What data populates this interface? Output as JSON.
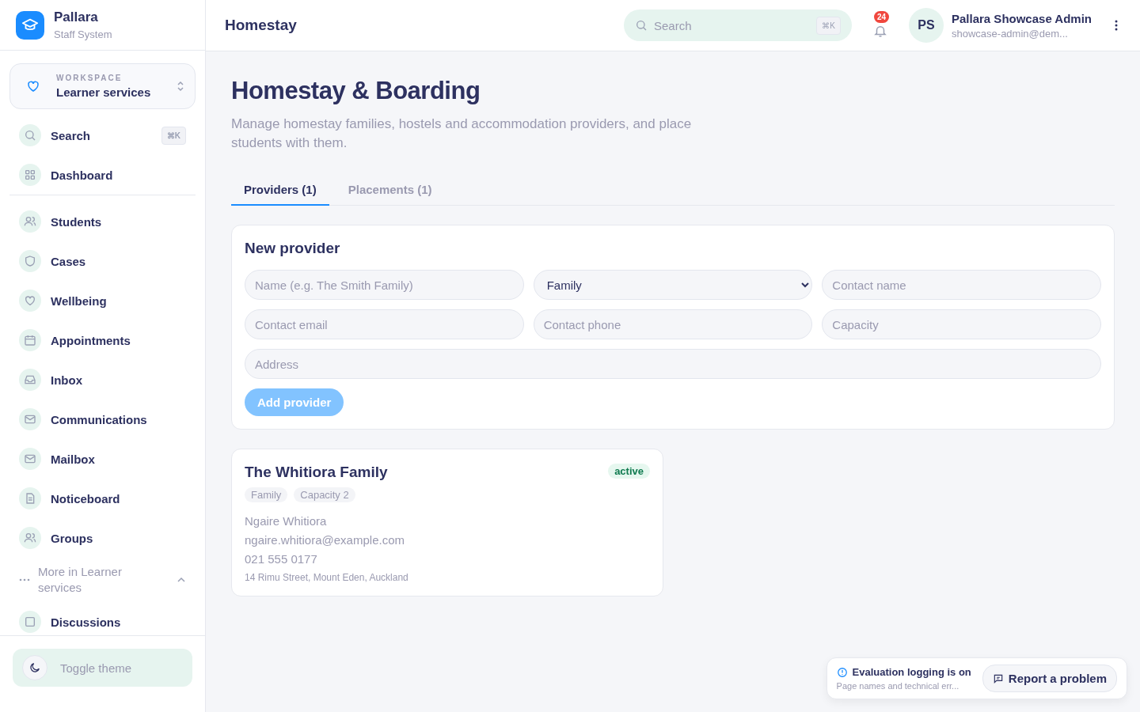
{
  "brand": {
    "name": "Pallara",
    "subtitle": "Staff System"
  },
  "workspace": {
    "label": "WORKSPACE",
    "name": "Learner services"
  },
  "nav_top": [
    {
      "label": "Search",
      "shortcut": "⌘K"
    },
    {
      "label": "Dashboard"
    }
  ],
  "nav_main": [
    {
      "label": "Students"
    },
    {
      "label": "Cases"
    },
    {
      "label": "Wellbeing"
    },
    {
      "label": "Appointments"
    },
    {
      "label": "Inbox"
    },
    {
      "label": "Communications"
    },
    {
      "label": "Mailbox"
    },
    {
      "label": "Noticeboard"
    },
    {
      "label": "Groups"
    }
  ],
  "more": {
    "label": "More in Learner services",
    "expanded": true,
    "items": [
      {
        "label": "Discussions"
      }
    ]
  },
  "toggle_theme": "Toggle theme",
  "header": {
    "title": "Homestay",
    "search": {
      "placeholder": "Search",
      "shortcut": "⌘K"
    },
    "notifications": "24",
    "user": {
      "initials": "PS",
      "name": "Pallara Showcase Admin",
      "email": "showcase-admin@dem..."
    }
  },
  "page": {
    "title": "Homestay & Boarding",
    "description": "Manage homestay families, hostels and accommodation providers, and place students with them."
  },
  "tabs": [
    {
      "label": "Providers (1)",
      "selected": true
    },
    {
      "label": "Placements (1)",
      "selected": false
    }
  ],
  "form": {
    "title": "New provider",
    "fields": [
      {
        "kind": "input",
        "placeholder": "Name (e.g. The Smith Family)"
      },
      {
        "kind": "select",
        "value": "Family"
      },
      {
        "kind": "input",
        "placeholder": "Contact name"
      },
      {
        "kind": "input",
        "placeholder": "Contact email"
      },
      {
        "kind": "input",
        "placeholder": "Contact phone"
      },
      {
        "kind": "input",
        "placeholder": "Capacity"
      },
      {
        "kind": "input",
        "placeholder": "Address",
        "wide": true
      }
    ],
    "button": {
      "label": "Add provider",
      "disabled": true
    }
  },
  "providers": [
    {
      "name": "The Whitiora Family",
      "status": "active",
      "tags": [
        "Family",
        "Capacity 2"
      ],
      "contact": "Ngaire Whitiora",
      "email": "ngaire.whitiora@example.com",
      "phone": "021 555 0177",
      "address": "14 Rimu Street, Mount Eden, Auckland"
    }
  ],
  "notice": {
    "title": "Evaluation logging is on",
    "text": "Page names and technical err...",
    "button": "Report a problem"
  }
}
